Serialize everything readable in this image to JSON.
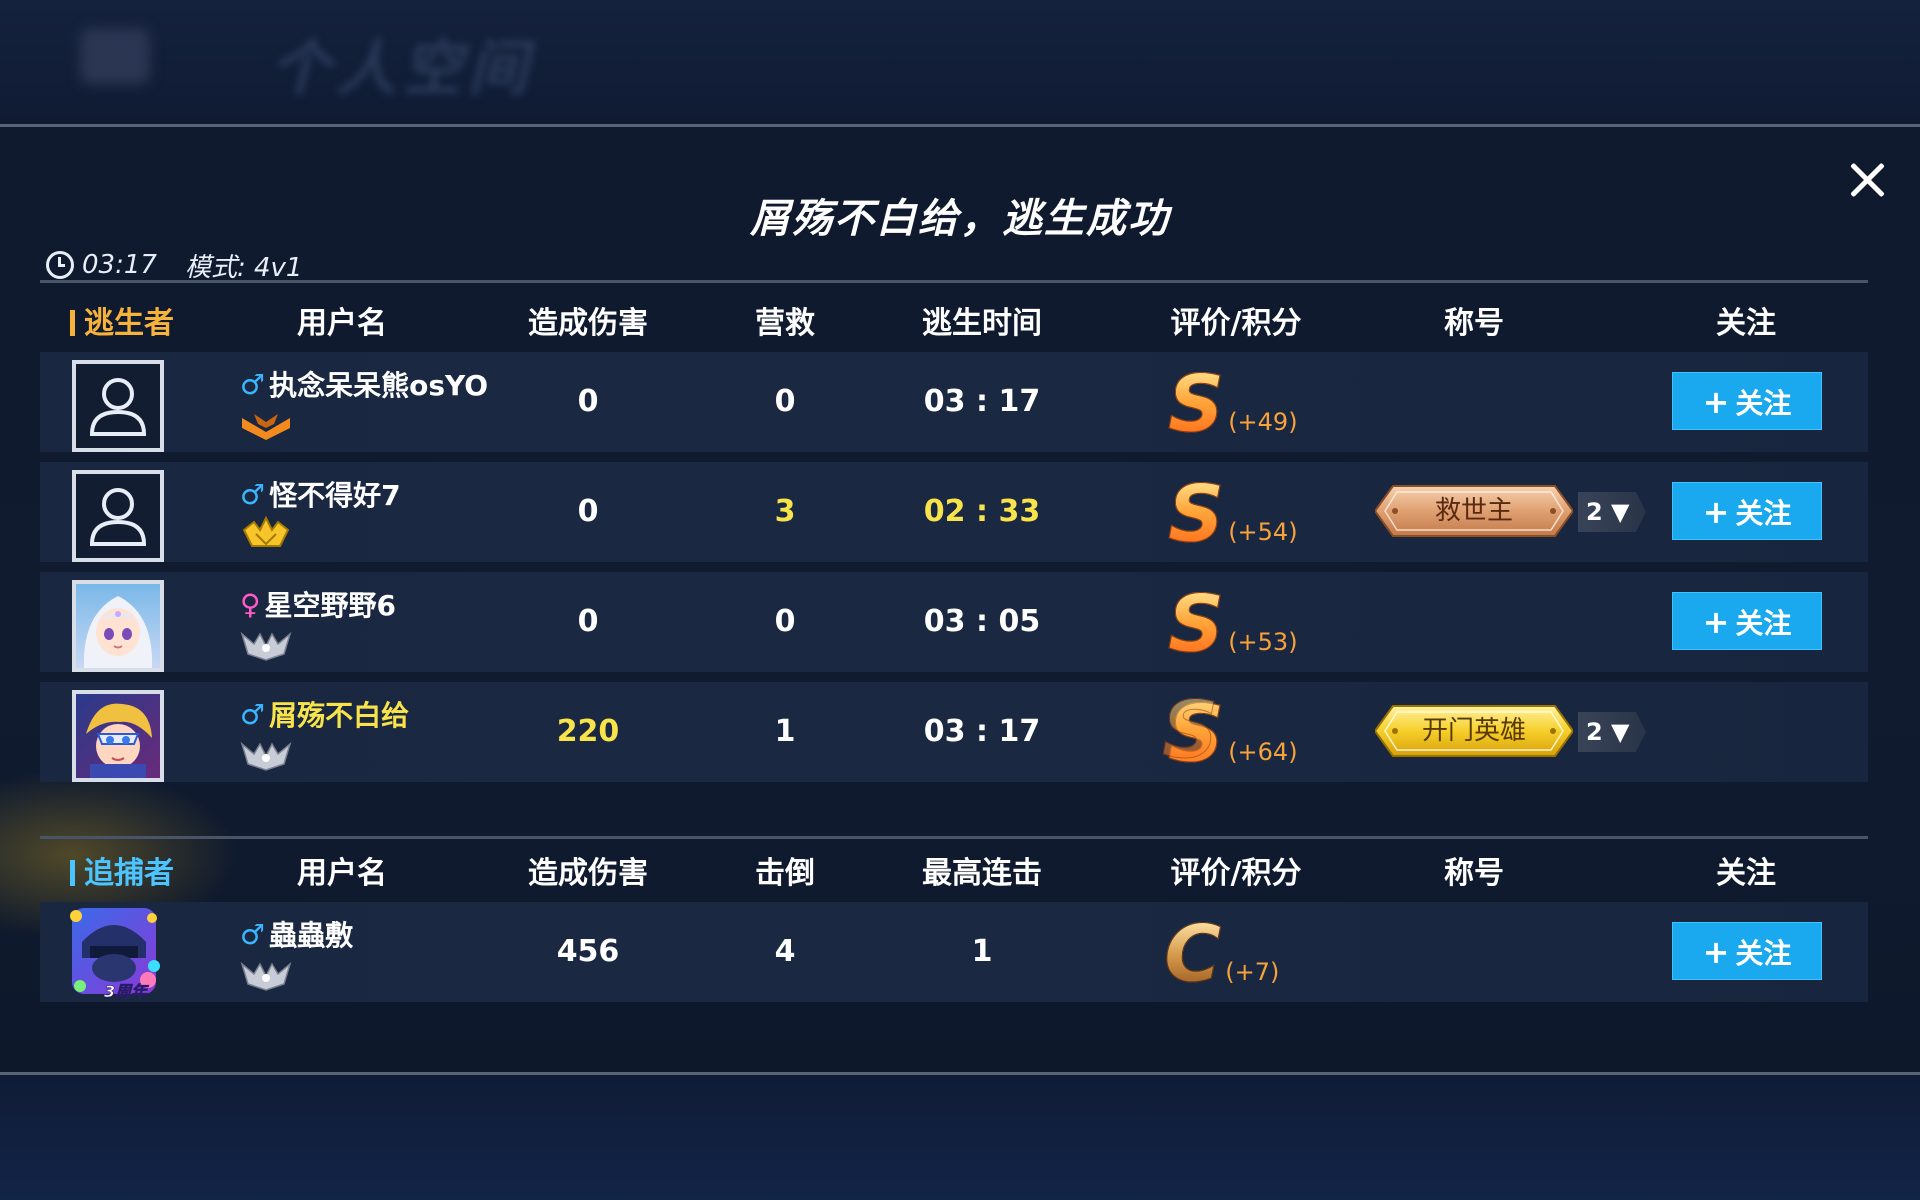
{
  "background": {
    "title": "个人空间"
  },
  "header": {
    "title": "屑殇不白给，逃生成功",
    "duration": "03:17",
    "mode": "模式: 4v1"
  },
  "survivors": {
    "role_label": "逃生者",
    "columns": [
      "用户名",
      "造成伤害",
      "营救",
      "逃生时间",
      "评价/积分",
      "称号",
      "关注"
    ],
    "rows": [
      {
        "name": "执念呆呆熊osYO",
        "gender": "male",
        "damage": "0",
        "rescues": "0",
        "escape_time": "03 : 17",
        "grade": "S",
        "points": "(+49)",
        "title": "",
        "title_count": "",
        "follow": "关注",
        "avatar": "placeholder",
        "rank_icon": "bronze-wing-icon"
      },
      {
        "name": "怪不得好7",
        "gender": "male",
        "damage": "0",
        "rescues": "3",
        "escape_time": "02 : 33",
        "grade": "S",
        "points": "(+54)",
        "title": "救世主",
        "title_count": "2",
        "follow": "关注",
        "avatar": "placeholder",
        "rank_icon": "gold-crown-icon"
      },
      {
        "name": "星空野野6",
        "gender": "female",
        "damage": "0",
        "rescues": "0",
        "escape_time": "03 : 05",
        "grade": "S",
        "points": "(+53)",
        "title": "",
        "title_count": "",
        "follow": "关注",
        "avatar": "girl-portrait",
        "rank_icon": "silver-wing-icon"
      },
      {
        "name": "屑殇不白给",
        "gender": "male",
        "damage": "220",
        "rescues": "1",
        "escape_time": "03 : 17",
        "grade": "S",
        "points": "(+64)",
        "title": "开门英雄",
        "title_count": "2",
        "follow": "",
        "avatar": "boy-portrait",
        "rank_icon": "silver-wing-icon"
      }
    ]
  },
  "hunter": {
    "role_label": "追捕者",
    "columns": [
      "用户名",
      "造成伤害",
      "击倒",
      "最高连击",
      "评价/积分",
      "称号",
      "关注"
    ],
    "row": {
      "name": "蟲蟲敷",
      "gender": "male",
      "damage": "456",
      "knockdowns": "4",
      "max_combo": "1",
      "grade": "C",
      "points": "(+7)",
      "follow": "关注",
      "avatar": "anniversary-portrait",
      "avatar_label": "3周年",
      "rank_icon": "silver-wing-icon"
    }
  },
  "gender_symbols": {
    "male": "♂",
    "female": "♀"
  },
  "colors": {
    "accent": "#1aa9ef",
    "survivor_role": "#f6b23a",
    "hunter_role": "#4cc4ff",
    "highlight": "#f8e34a",
    "points": "#f7a23a"
  }
}
